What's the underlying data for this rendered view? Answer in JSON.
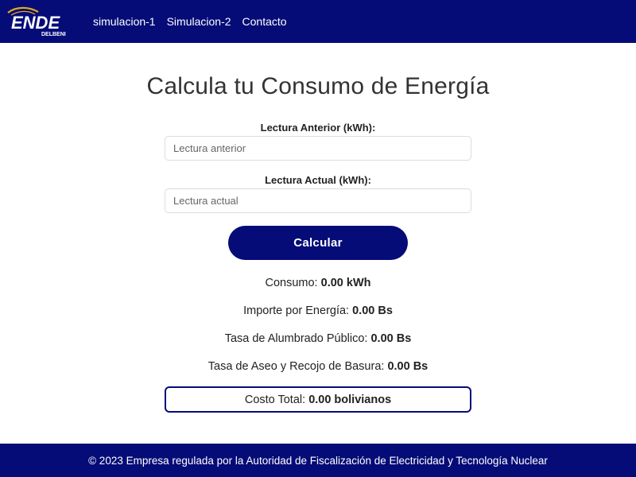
{
  "brand": {
    "logo_text": "ENDE",
    "logo_subtext": "DELBENI"
  },
  "nav": {
    "links": [
      "simulacion-1",
      "Simulacion-2",
      "Contacto"
    ]
  },
  "main": {
    "title": "Calcula tu Consumo de Energía",
    "lectura_anterior": {
      "label": "Lectura Anterior (kWh):",
      "placeholder": "Lectura anterior",
      "value": ""
    },
    "lectura_actual": {
      "label": "Lectura Actual (kWh):",
      "placeholder": "Lectura actual",
      "value": ""
    },
    "calcular_label": "Calcular",
    "results": {
      "consumo": {
        "label": "Consumo:",
        "value": "0.00 kWh"
      },
      "importe": {
        "label": "Importe por Energía:",
        "value": "0.00 Bs"
      },
      "alumbrado": {
        "label": "Tasa de Alumbrado Público:",
        "value": "0.00 Bs"
      },
      "aseo": {
        "label": "Tasa de Aseo y Recojo de Basura:",
        "value": "0.00 Bs"
      },
      "total": {
        "label": "Costo Total:",
        "value": "0.00 bolivianos"
      }
    }
  },
  "footer": {
    "text": "© 2023 Empresa regulada por la Autoridad de Fiscalización de Electricidad y Tecnología Nuclear"
  },
  "colors": {
    "primary": "#050c78",
    "accent": "#e0a91c",
    "background": "#ffffff"
  }
}
